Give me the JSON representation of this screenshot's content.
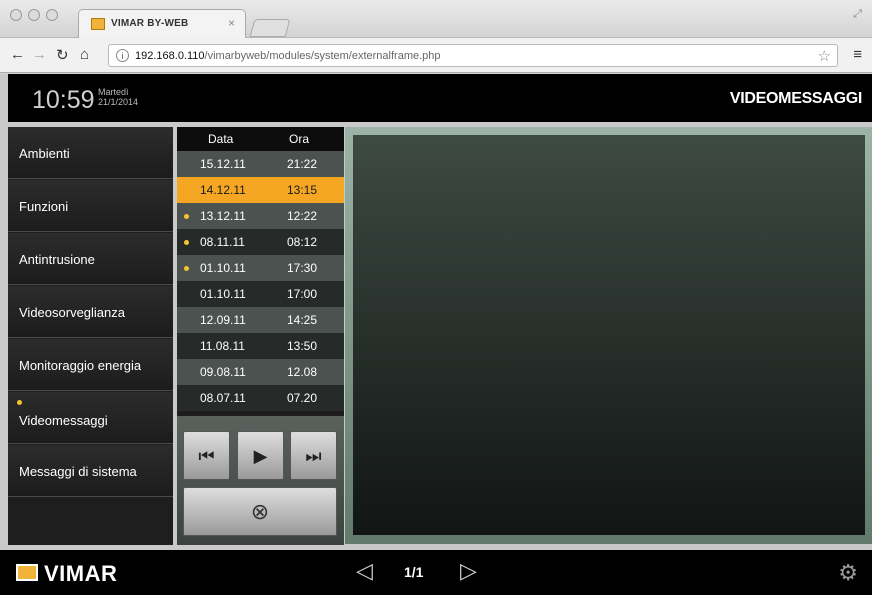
{
  "browser": {
    "tab_title": "VIMAR BY-WEB",
    "tab_close": "×",
    "url_host": "192.168.0.110",
    "url_path": "/vimarbyweb/modules/system/externalframe.php"
  },
  "header": {
    "time": "10:59",
    "weekday": "Martedì",
    "date": "21/1/2014",
    "title": "VIDEOMESSAGGI"
  },
  "sidebar": {
    "items": [
      {
        "label": "Ambienti"
      },
      {
        "label": "Funzioni"
      },
      {
        "label": "Antintrusione"
      },
      {
        "label": "Videosorveglianza"
      },
      {
        "label": "Monitoraggio energia"
      },
      {
        "label": "Videomessaggi"
      },
      {
        "label": "Messaggi di sistema"
      }
    ]
  },
  "messages": {
    "col_data": "Data",
    "col_ora": "Ora",
    "rows": [
      {
        "data": "15.12.11",
        "ora": "21:22"
      },
      {
        "data": "14.12.11",
        "ora": "13:15"
      },
      {
        "data": "13.12.11",
        "ora": "12:22"
      },
      {
        "data": "08.11.11",
        "ora": "08:12"
      },
      {
        "data": "01.10.11",
        "ora": "17:30"
      },
      {
        "data": "01.10.11",
        "ora": "17:00"
      },
      {
        "data": "12.09.11",
        "ora": "14:25"
      },
      {
        "data": "11.08.11",
        "ora": "13:50"
      },
      {
        "data": "09.08.11",
        "ora": "12.08"
      },
      {
        "data": "08.07.11",
        "ora": "07.20"
      }
    ]
  },
  "footer": {
    "brand": "VIMAR",
    "page": "1/1"
  },
  "colors": {
    "selected_row": "#f5a623",
    "unread_dot": "#f7c531"
  }
}
